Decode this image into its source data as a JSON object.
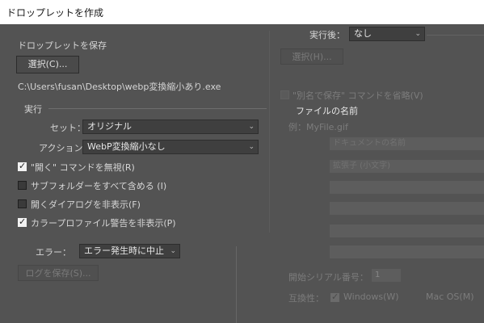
{
  "window": {
    "title": "ドロップレットを作成"
  },
  "save_section": {
    "label": "ドロップレットを保存",
    "choose_button": "選択(C)...",
    "path": "C:\\Users\\fusan\\Desktop\\webp変換縮小あり.exe"
  },
  "play_section": {
    "label": "実行",
    "set_label": "セット：",
    "set_value": "オリジナル",
    "action_label": "アクション：",
    "action_value": "WebP変換縮小なし",
    "options": [
      {
        "label": "\"開く\" コマンドを無視(R)",
        "checked": true
      },
      {
        "label": "サブフォルダーをすべて含める (I)",
        "checked": false
      },
      {
        "label": "開くダイアログを非表示(F)",
        "checked": false
      },
      {
        "label": "カラープロファイル警告を非表示(P)",
        "checked": true
      }
    ]
  },
  "error_section": {
    "label": "エラー：",
    "value": "エラー発生時に中止",
    "save_log_button": "ログを保存(S)..."
  },
  "destination": {
    "label": "実行後：",
    "value": "なし",
    "choose_button": "選択(H)...",
    "override_label": "\"別名で保存\" コマンドを省略(V)",
    "file_naming_label": "ファイルの名前",
    "example": "例：MyFile.gif",
    "naming_fields": [
      "ドキュメントの名前",
      "拡張子 (小文字)",
      "",
      "",
      "",
      "",
      ""
    ],
    "serial_label": "開始シリアル番号：",
    "serial_value": "1",
    "compat_label": "互換性：",
    "compat_options": [
      {
        "label": "Windows(W)",
        "checked": true
      },
      {
        "label": "Mac OS(M)",
        "checked": false
      }
    ]
  },
  "chevron": "⌄"
}
